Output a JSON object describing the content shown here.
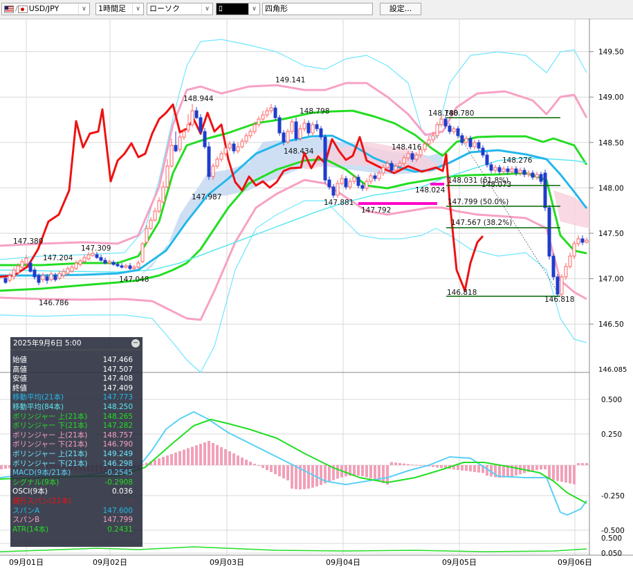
{
  "toolbar": {
    "pair": "USD/JPY",
    "timeframe": "1時間足",
    "chart_type": "ローソク",
    "drawing_icon": "ﾛ",
    "drawing_tool": "四角形",
    "settings_label": "設定..."
  },
  "colors": {
    "grid": "#d8d8d8",
    "candle_up": "#ff6060",
    "candle_down": "#1f3ccc",
    "ma21": "#23b7ea",
    "ma84": "#5de8f0",
    "bb1": "#22dd22",
    "bb2": "#f7a1c4",
    "bb3": "#6ee6ff",
    "conv": "#ee1111",
    "cloud": "#c9dcf3",
    "cloud_pink": "#f7cfdc",
    "fibo": "#006400",
    "macd": "#5ad0f5",
    "signal": "#22dd22",
    "osci": "#f2a0b8"
  },
  "price_axis": {
    "ticks": [
      "149.50",
      "149.00",
      "148.50",
      "148.00",
      "147.50",
      "147.00",
      "146.50"
    ],
    "boundary_label": "146.085"
  },
  "sub_axis": {
    "ticks": [
      "0.500",
      "0.250",
      "-0.250",
      "-0.500"
    ],
    "atr_ticks": [
      "0.500",
      "0.050"
    ]
  },
  "date_labels": [
    "09月01日",
    "09月02日",
    "09月03日",
    "09月04日",
    "09月05日",
    "09月06日"
  ],
  "price_annotations": {
    "high_1": "147.380",
    "high_2": "147.204",
    "high_3": "147.309",
    "low_1": "146.786",
    "low_2": "147.048",
    "high_4": "148.944",
    "low_3": "147.987",
    "high_5": "149.141",
    "high_6": "148.798",
    "mid_1": "148.434",
    "low_4": "147.881",
    "low_5": "147.792",
    "high_7": "148.416",
    "mark_1": "148.024",
    "high_8": "148.780",
    "high_9": "148.780",
    "high_10": "148.276",
    "low_6": "146.818",
    "low_7": "146.818",
    "mid_2": "148.073"
  },
  "fibo_labels": [
    "148.031 (61.8%)",
    "147.799 (50.0%)",
    "147.567 (38.2%)"
  ],
  "info_panel": {
    "title": "2025年9月6日 5:00",
    "rows": [
      {
        "label": "始値",
        "value": "147.466",
        "color": "#ffffff"
      },
      {
        "label": "高値",
        "value": "147.507",
        "color": "#ffffff"
      },
      {
        "label": "安値",
        "value": "147.408",
        "color": "#ffffff"
      },
      {
        "label": "終値",
        "value": "147.409",
        "color": "#ffffff"
      },
      {
        "label": "移動平均(21本)",
        "value": "147.773",
        "color": "#23b7ea"
      },
      {
        "label": "移動平均(84本)",
        "value": "148.250",
        "color": "#5de8f0"
      },
      {
        "label": "ボリンジャー 上(21本)",
        "value": "148.265",
        "color": "#22dd22"
      },
      {
        "label": "ボリンジャー 下(21本)",
        "value": "147.282",
        "color": "#22dd22"
      },
      {
        "label": "ボリンジャー 上(21本)",
        "value": "148.757",
        "color": "#f7a1c4"
      },
      {
        "label": "ボリンジャー 下(21本)",
        "value": "146.790",
        "color": "#f7a1c4"
      },
      {
        "label": "ボリンジャー 上(21本)",
        "value": "149.249",
        "color": "#6ee6ff"
      },
      {
        "label": "ボリンジャー 下(21本)",
        "value": "146.298",
        "color": "#6ee6ff"
      },
      {
        "label": "MACD(9本/21本)",
        "value": "-0.2545",
        "color": "#5ad0f5"
      },
      {
        "label": "シグナル(9本)",
        "value": "-0.2908",
        "color": "#22dd22"
      },
      {
        "label": "OSCI(9本)",
        "value": "0.036",
        "color": "#ffffff"
      },
      {
        "label": "遅行スパン(21本)",
        "value": "-",
        "color": "#ee1111"
      },
      {
        "label": "スパンA",
        "value": "147.600",
        "color": "#23b7ea"
      },
      {
        "label": "スパンB",
        "value": "147.799",
        "color": "#f7a1c4"
      },
      {
        "label": "ATR(14本)",
        "value": "0.2431",
        "color": "#22dd22"
      }
    ]
  }
}
